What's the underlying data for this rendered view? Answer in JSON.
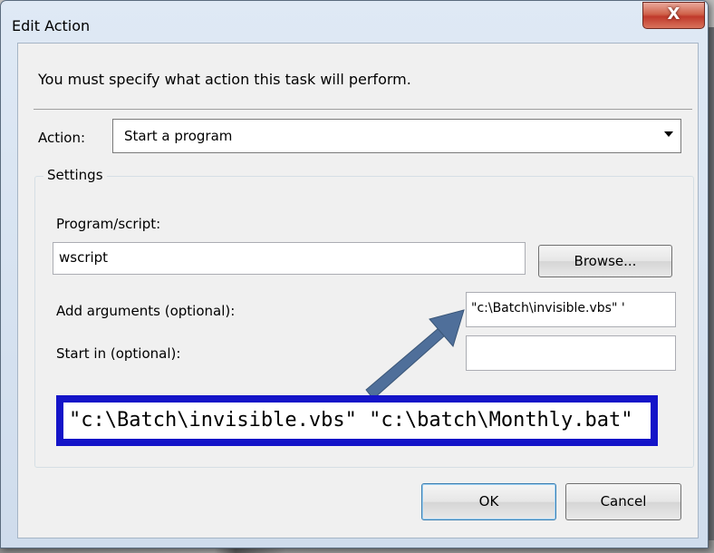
{
  "window": {
    "title": "Edit Action",
    "close_glyph": "X"
  },
  "dialog": {
    "instruction": "You must specify what action this task will perform.",
    "action": {
      "label": "Action:",
      "selected_value": "Start a program"
    },
    "settings": {
      "group_label": "Settings",
      "program_script": {
        "label": "Program/script:",
        "value": "wscript"
      },
      "browse_button": "Browse...",
      "add_arguments": {
        "label": "Add arguments (optional):",
        "value": "\"c:\\Batch\\invisible.vbs\" '"
      },
      "start_in": {
        "label": "Start in (optional):",
        "value": ""
      }
    },
    "ok_button": "OK",
    "cancel_button": "Cancel"
  },
  "annotation": {
    "callout_text": "\"c:\\Batch\\invisible.vbs\" \"c:\\batch\\Monthly.bat\"",
    "arrow_color": "#4f6f9a",
    "box_color": "#1414c8"
  }
}
